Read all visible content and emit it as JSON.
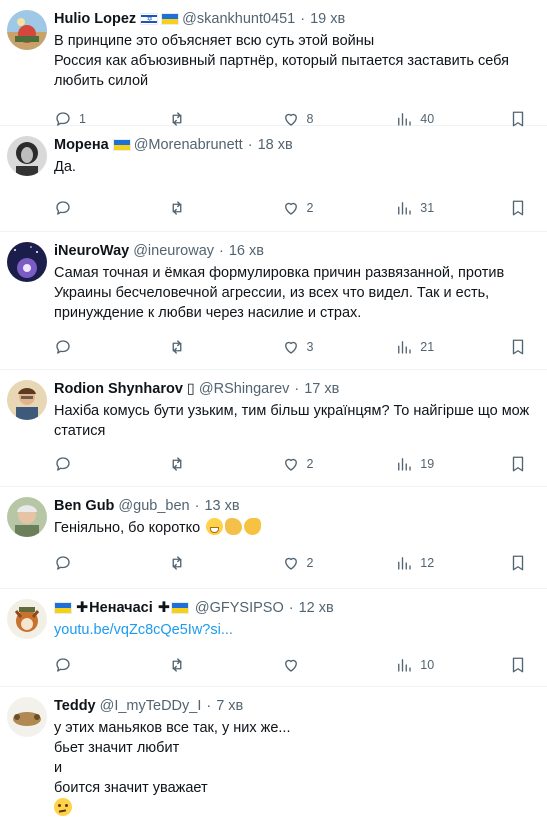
{
  "tweets": [
    {
      "name": "Hulio Lopez",
      "flags": [
        "il",
        "ua"
      ],
      "handle": "@skankhunt0451",
      "time": "19 хв",
      "lines": [
        "В принципе это объясняет всю суть этой войны",
        "Россия как абъюзивный партнёр, который пытается заставить себя",
        "любить силой"
      ],
      "replies": "1",
      "retweets": "",
      "likes": "8",
      "views": "40",
      "avatar": "landscape"
    },
    {
      "name": "Морена",
      "flags": [
        "ua"
      ],
      "handle": "@Morenabrunett",
      "time": "18 хв",
      "lines": [
        "Да."
      ],
      "replies": "",
      "retweets": "",
      "likes": "2",
      "views": "31",
      "avatar": "woman"
    },
    {
      "name": "iNeuroWay",
      "flags": [],
      "handle": "@ineuroway",
      "time": "16 хв",
      "lines": [
        "Самая точная и ёмкая формулировка причин развязанной, против",
        "Украины бесчеловечной агрессии, из всех что видел. Так и есть,",
        "принуждение к любви через насилие и страх."
      ],
      "replies": "",
      "retweets": "",
      "likes": "3",
      "views": "21",
      "avatar": "space"
    },
    {
      "name": "Rodion Shynharov ▯",
      "flags": [],
      "handle": "@RShingarev",
      "time": "17 хв",
      "lines": [
        "Нахіба комусь бути узьким, тим більш українцям? То найгірше що мож",
        "статися"
      ],
      "replies": "",
      "retweets": "",
      "likes": "2",
      "views": "19",
      "avatar": "man"
    },
    {
      "name": "Ben Gub",
      "flags": [],
      "handle": "@gub_ben",
      "time": "13 хв",
      "lines": [
        "Геніяльно, бо коротко"
      ],
      "emojis": [
        "grin",
        "hands",
        "clap"
      ],
      "replies": "",
      "retweets": "",
      "likes": "2",
      "views": "12",
      "avatar": "elder"
    },
    {
      "name": "Неначасі",
      "flags": [
        "ua"
      ],
      "name_decor": "ua-cross",
      "handle": "@GFYSIPSO",
      "time": "12 хв",
      "lines": [],
      "link": "youtu.be/vqZc8cQe5Iw?si...",
      "replies": "",
      "retweets": "",
      "likes": "",
      "views": "10",
      "avatar": "dog"
    },
    {
      "name": "Teddy",
      "flags": [],
      "handle": "@I_myTeDDy_I",
      "time": "7 хв",
      "lines": [
        "у этих маньяков все так, у них же...",
        "бьет значит любит",
        "и",
        "боится значит уважает"
      ],
      "emojis_after": [
        "think"
      ],
      "replies": "",
      "retweets": "",
      "likes": "",
      "views": "",
      "avatar": "animal"
    }
  ],
  "colors": {
    "text": "#0f1419",
    "muted": "#536471",
    "link": "#1d9bf0",
    "divider": "#eff3f4"
  },
  "icons": [
    "reply-icon",
    "retweet-icon",
    "like-icon",
    "views-icon",
    "bookmark-icon"
  ]
}
